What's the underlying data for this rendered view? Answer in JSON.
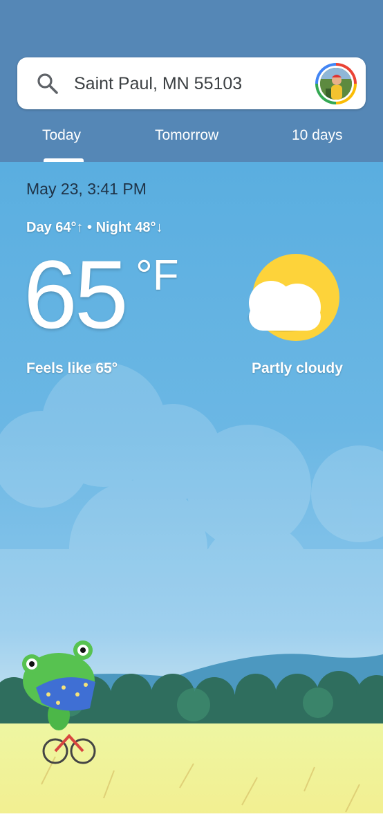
{
  "search": {
    "location": "Saint Paul, MN 55103"
  },
  "tabs": [
    "Today",
    "Tomorrow",
    "10 days"
  ],
  "current": {
    "datetime": "May 23, 3:41 PM",
    "day_night": "Day 64°↑ • Night 48°↓",
    "temperature": "65",
    "unit": "°F",
    "feels_like": "Feels like 65°",
    "condition": "Partly cloudy",
    "condition_icon": "partly-cloudy-icon"
  },
  "colors": {
    "header_bg": "#5587b6",
    "sky": "#5aaee0",
    "sun": "#fdd33a"
  }
}
